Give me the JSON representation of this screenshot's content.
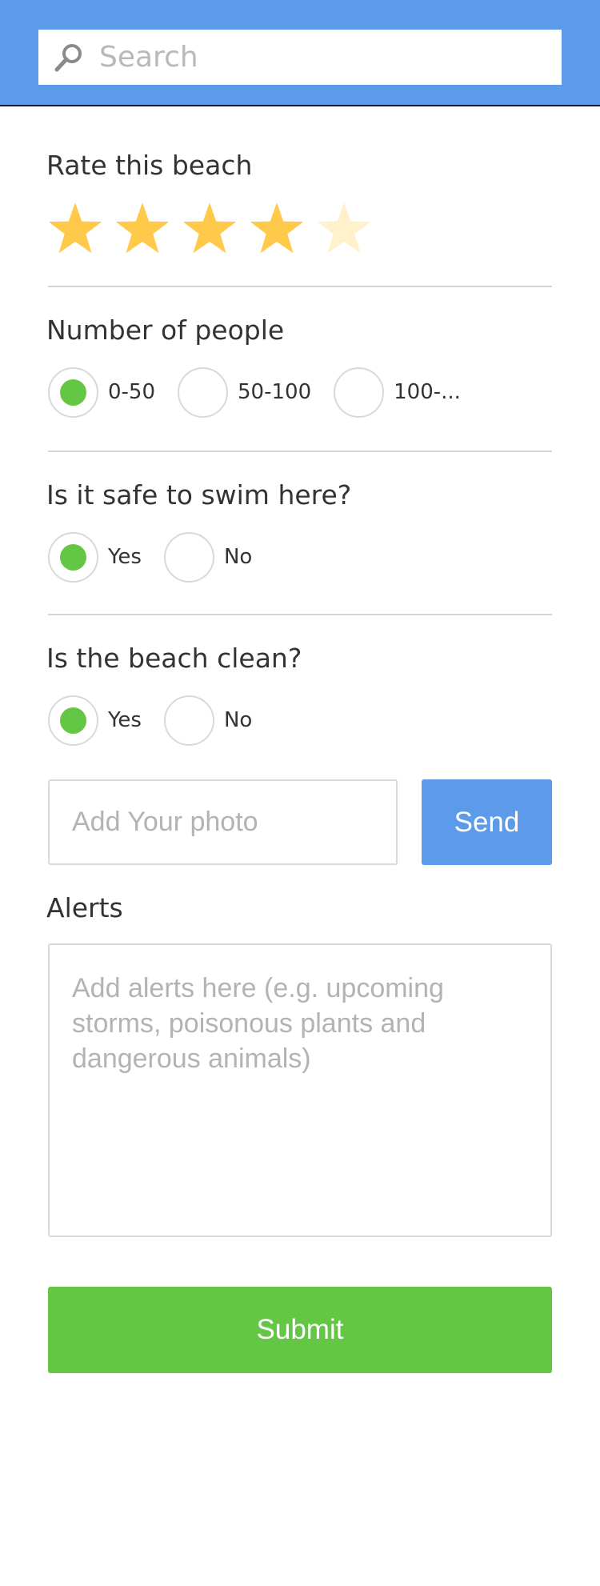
{
  "search": {
    "placeholder": "Search",
    "icon": "search-icon"
  },
  "rating": {
    "title": "Rate this beach",
    "value": 4,
    "max": 5,
    "filled_color": "#ffc94a",
    "empty_color": "#fff1cc"
  },
  "people": {
    "title": "Number of people",
    "options": [
      "0-50",
      "50-100",
      "100-..."
    ],
    "selected": "0-50"
  },
  "swim": {
    "title": "Is it safe to swim here?",
    "options": [
      "Yes",
      "No"
    ],
    "selected": "Yes"
  },
  "clean": {
    "title": "Is the beach clean?",
    "options": [
      "Yes",
      "No"
    ],
    "selected": "Yes"
  },
  "photo": {
    "placeholder": "Add Your photo",
    "send_label": "Send"
  },
  "alerts": {
    "title": "Alerts",
    "placeholder": "Add alerts here (e.g. upcoming storms, poisonous plants and dangerous animals)"
  },
  "submit_label": "Submit",
  "colors": {
    "header": "#5b9bea",
    "accent_green": "#63c644",
    "accent_blue": "#5b9bea"
  }
}
